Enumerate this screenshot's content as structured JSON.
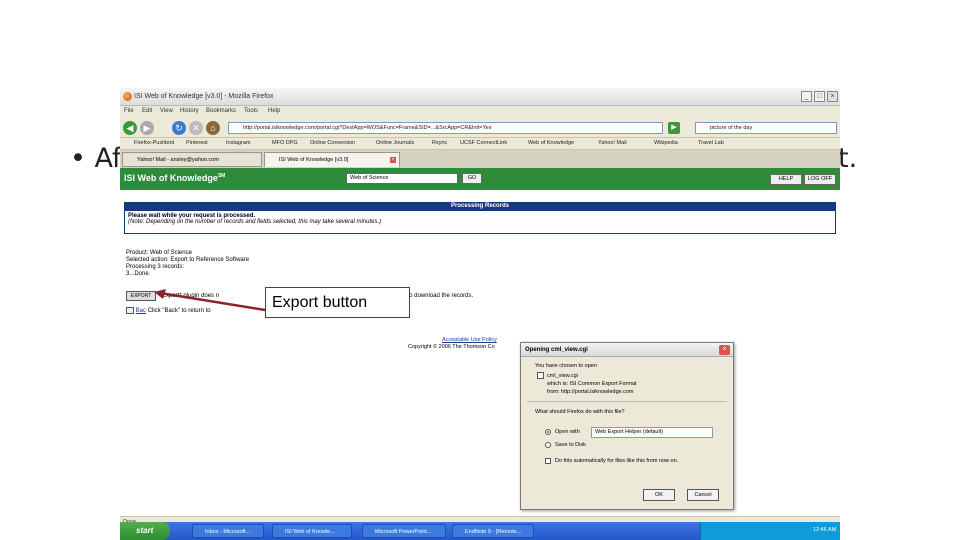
{
  "slide": {
    "bullet_visible_start": "• Aft",
    "bullet_visible_end": "t."
  },
  "browser": {
    "title": "ISI Web of Knowledge [v3.0] - Mozilla Firefox",
    "menu": [
      "File",
      "Edit",
      "View",
      "History",
      "Bookmarks",
      "Tools",
      "Help"
    ],
    "url": "http://portal.isiknowledge.com/portal.cgi?DestApp=WOS&Func=Frame&SID=...&SrcApp=CR&Init=Yes",
    "search_value": "picture of the day",
    "bookmarks": [
      "Firefox-Pushbird",
      "Pinterest",
      "Instagram",
      "MFO DPG",
      "Online Conversion",
      "Online Journals",
      "Rsync",
      "UCSF ConnectLink",
      "Web of Knowledge",
      "Yahoo! Mail",
      "Wikipedia",
      "Travel Lab"
    ],
    "tabs": [
      "Yahoo! Mail - ansley@yahoo.com",
      "ISI Web of Knowledge [v3.0]"
    ],
    "status": "Done"
  },
  "isi": {
    "logo": "ISI Web of Knowledge",
    "logo_sup": "SM",
    "database": "Web of Science",
    "go": "GO",
    "buttons": [
      "HELP",
      "LOG OFF"
    ],
    "processing_title": "Processing Records",
    "wait_line1": "Please wait while your request is processed.",
    "wait_line2": "(Note: Depending on the number of records and fields selected, this may take several minutes.)",
    "product": "Product: Web of Science",
    "selected_action": "Selected action: Export to Reference Software",
    "processing": "Processing 3 records:",
    "done": "3...Done.",
    "export_label": "EXPORT",
    "export_desc_a": "Export* plugin does n",
    "export_desc_b": "rt\" to download the records.",
    "back_label": "Bac",
    "back_desc": "Click \"Back\" to return to",
    "policy": "Acceptable Use Policy",
    "copyright": "Copyright © 2006 The Thomson Co"
  },
  "dialog": {
    "title": "Opening cml_view.cgi",
    "intro": "You have chosen to open",
    "filename": "cml_view.cgi",
    "which_is": "which is: ISI Common Export Format",
    "from": "from: http://portal.isiknowledge.com",
    "question": "What should Firefox do with this file?",
    "open_with": "Open with",
    "open_with_app": "Web Export Helper (default)",
    "save_to_disk": "Save to Disk",
    "auto_label": "Do this automatically for files like this from now on.",
    "ok": "OK",
    "cancel": "Cancel"
  },
  "taskbar": {
    "start": "start",
    "tasks": [
      "Inbox - Microsoft...",
      "ISI Web of Knowle...",
      "Microsoft PowerPoint...",
      "EndNote 9 - [Remote..."
    ],
    "clock": "12:46 AM"
  },
  "annotation": {
    "label": "Export button"
  },
  "colors": {
    "isi_green": "#2e8b3a",
    "isi_blue": "#143a82",
    "callout_border": "#8b2232",
    "arrow": "#8b2232"
  }
}
